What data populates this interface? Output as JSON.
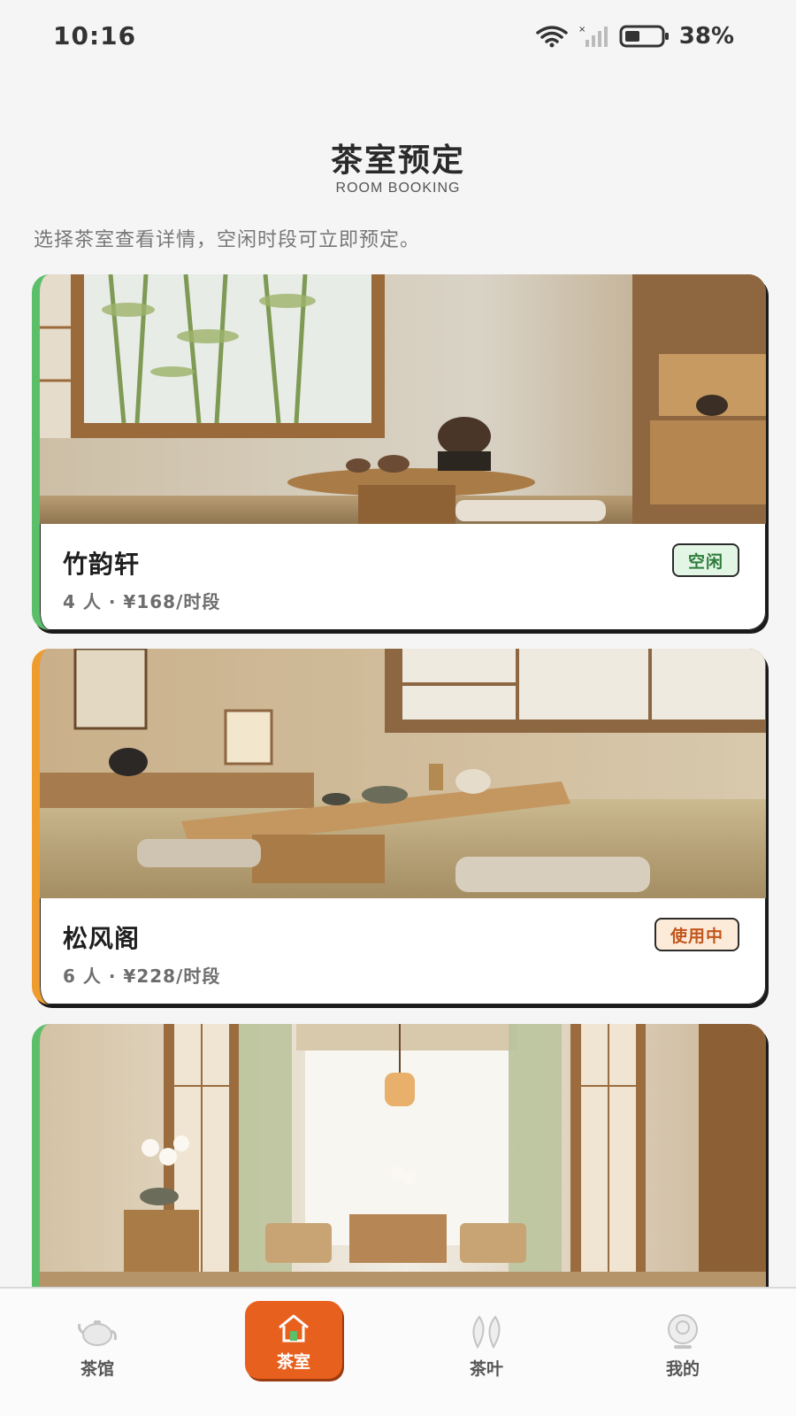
{
  "status_bar": {
    "time": "10:16",
    "battery": "38%",
    "icons": [
      "wifi-icon",
      "signal-icon",
      "battery-icon"
    ]
  },
  "header": {
    "title": "茶室预定",
    "subtitle": "ROOM BOOKING",
    "description": "选择茶室查看详情，空闲时段可立即预定。"
  },
  "rooms": [
    {
      "name": "竹韵轩",
      "meta": "4 人 · ¥168/时段",
      "status": "空闲",
      "status_color": "#2e7d3b",
      "accent": "#5bbf6a"
    },
    {
      "name": "松风阁",
      "meta": "6 人 · ¥228/时段",
      "status": "使用中",
      "status_color": "#c2561c",
      "accent": "#ef9c2e"
    },
    {
      "accent": "#5bbf6a"
    }
  ],
  "nav": {
    "items": [
      {
        "label": "茶馆",
        "icon": "teapot-icon"
      },
      {
        "label": "茶室",
        "icon": "home-icon",
        "active": true
      },
      {
        "label": "茶叶",
        "icon": "leaf-icon"
      },
      {
        "label": "我的",
        "icon": "user-icon"
      }
    ],
    "active_color": "#e8601e"
  }
}
